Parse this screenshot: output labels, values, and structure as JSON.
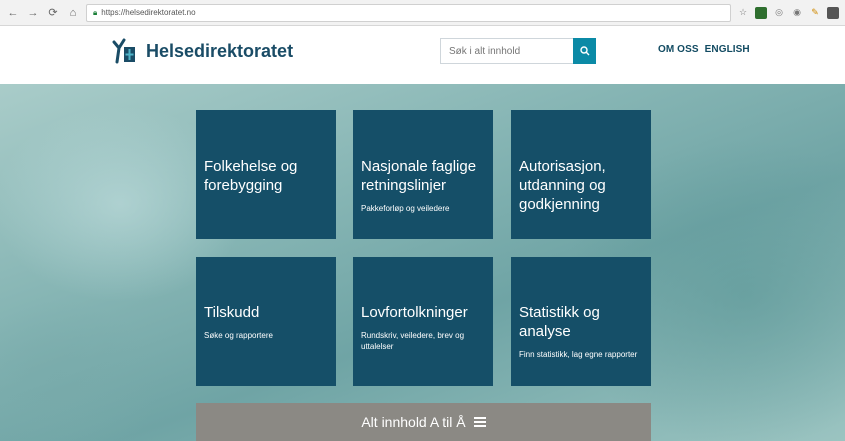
{
  "browser": {
    "url": "https://helsedirektoratet.no"
  },
  "header": {
    "logo_text": "Helsedirektoratet",
    "search_placeholder": "Søk i alt innhold",
    "nav": [
      "OM OSS",
      "ENGLISH"
    ]
  },
  "tiles": [
    {
      "title": "Folkehelse og forebygging",
      "subtitle": ""
    },
    {
      "title": "Nasjonale faglige retningslinjer",
      "subtitle": "Pakkeforløp og veiledere"
    },
    {
      "title": "Autorisasjon, utdanning og godkjenning",
      "subtitle": ""
    },
    {
      "title": "Tilskudd",
      "subtitle": "Søke og rapportere"
    },
    {
      "title": "Lovfortolkninger",
      "subtitle": "Rundskriv, veiledere, brev og uttalelser"
    },
    {
      "title": "Statistikk og analyse",
      "subtitle": "Finn statistikk, lag egne rapporter"
    }
  ],
  "all_content": {
    "label": "Alt innhold A til Å"
  },
  "colors": {
    "tile_bg": "#154f68",
    "brand": "#1a4c66",
    "search_button": "#0b8aa6",
    "all_bar_bg": "#8b8984"
  }
}
